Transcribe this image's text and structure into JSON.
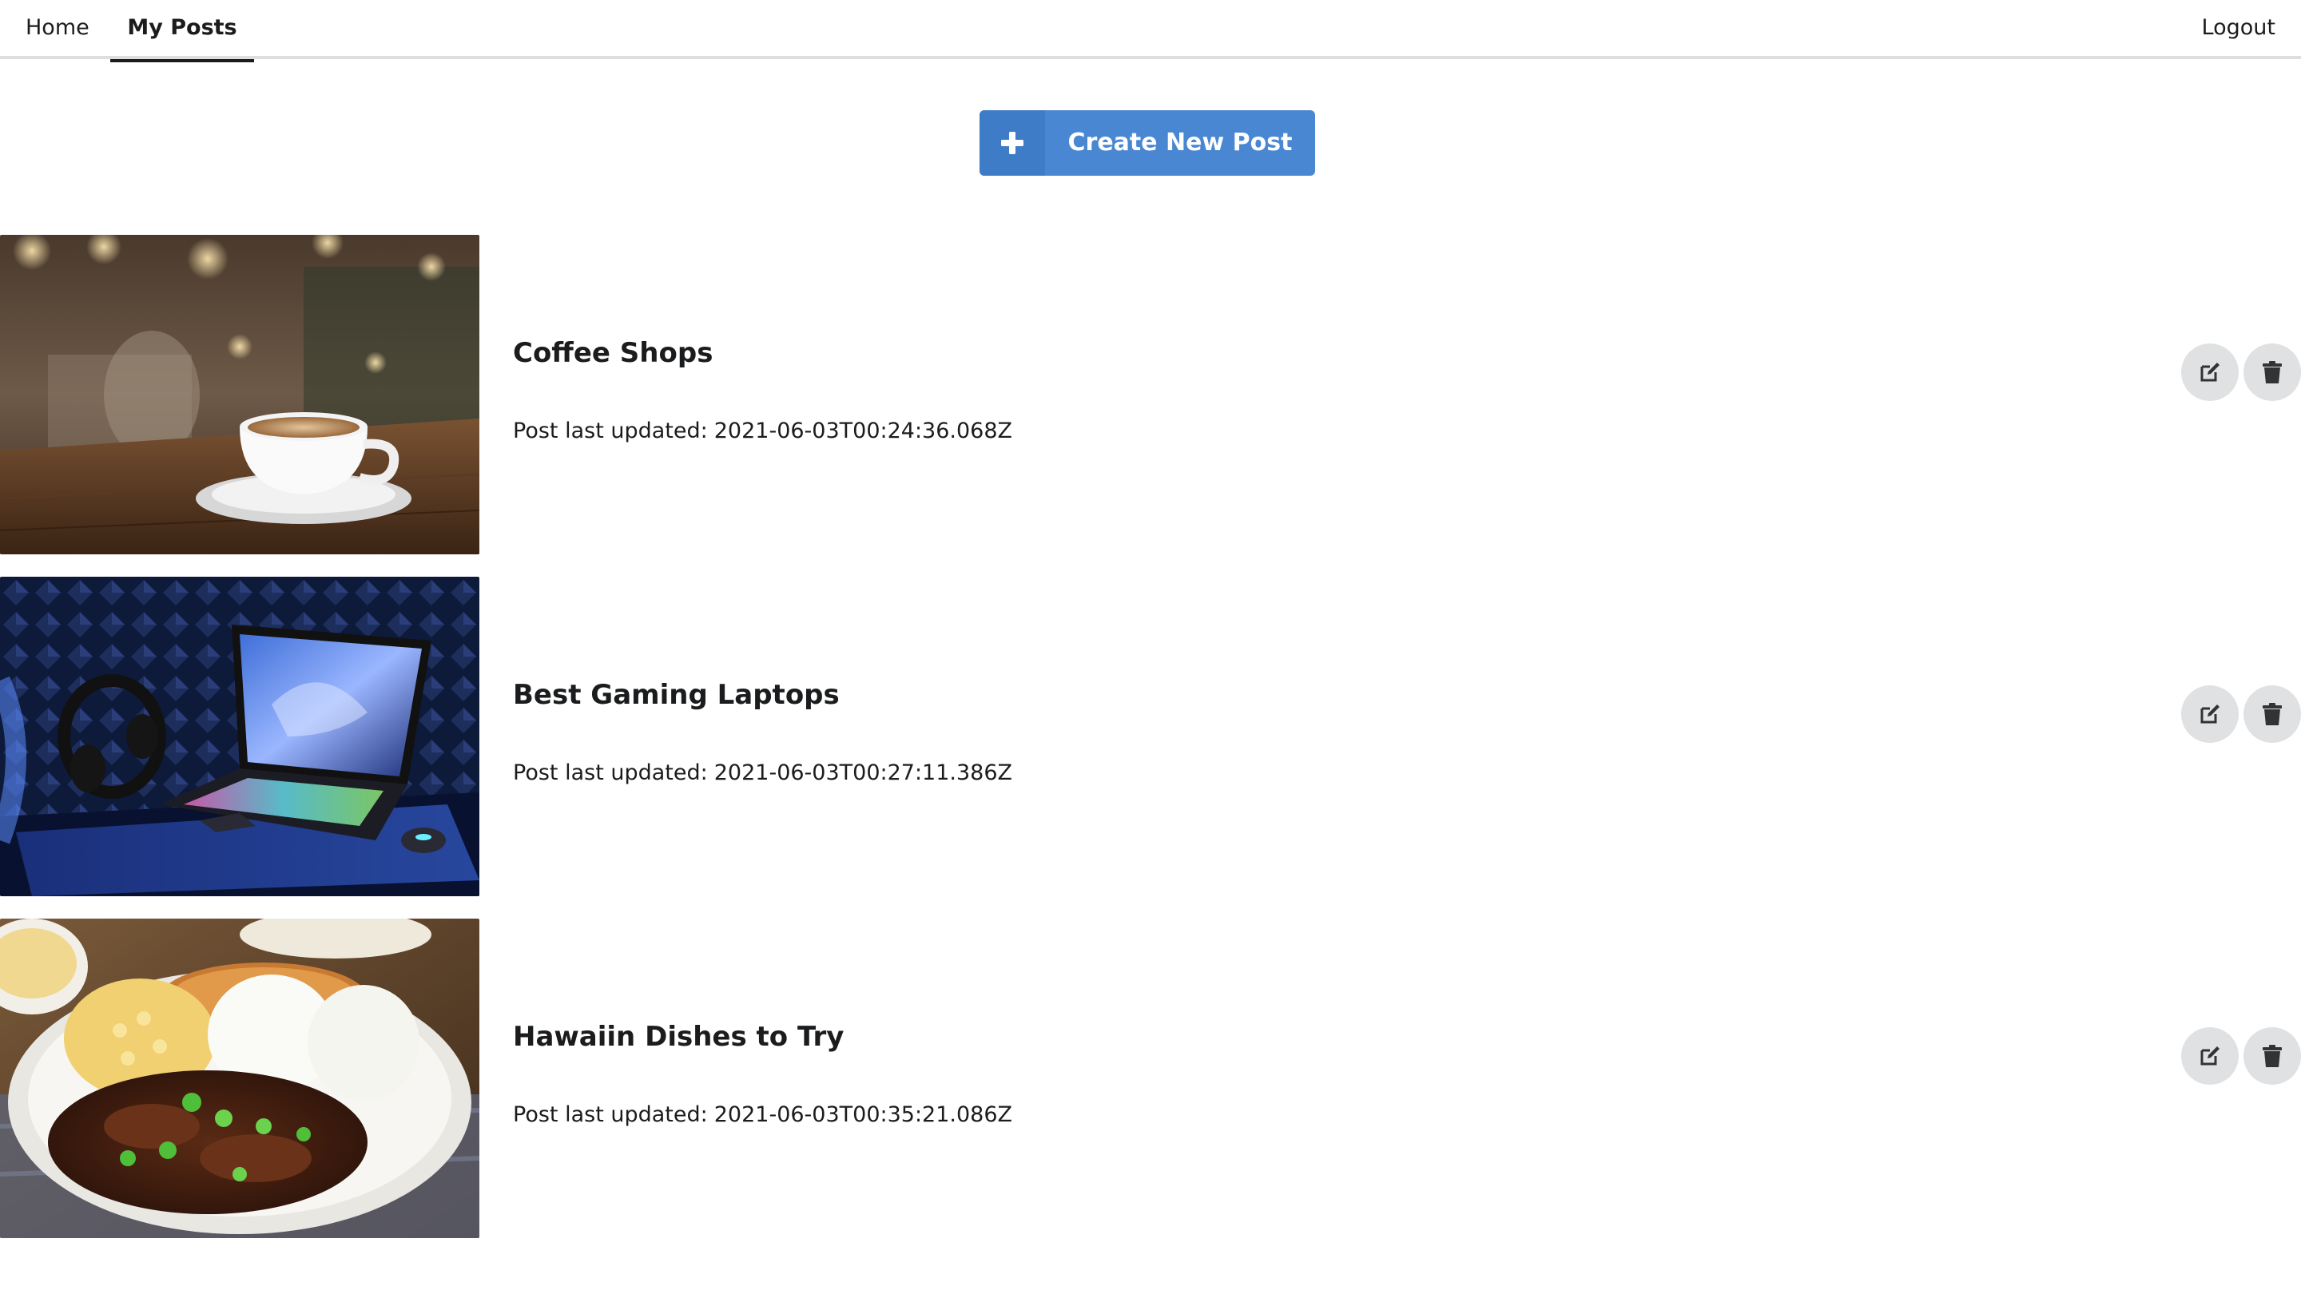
{
  "nav": {
    "home_label": "Home",
    "my_posts_label": "My Posts",
    "logout_label": "Logout",
    "active_tab": "My Posts"
  },
  "create_button": {
    "label": "Create New Post",
    "icon": "plus-icon",
    "color": "#4a87d2"
  },
  "posts": [
    {
      "title": "Coffee Shops",
      "updated_prefix": "Post last updated:",
      "updated_at": "2021-06-03T00:24:36.068Z",
      "image": "coffee-cup-photo",
      "actions": [
        "edit-icon",
        "trash-icon"
      ]
    },
    {
      "title": "Best Gaming Laptops",
      "updated_prefix": "Post last updated:",
      "updated_at": "2021-06-03T00:27:11.386Z",
      "image": "gaming-laptop-photo",
      "actions": [
        "edit-icon",
        "trash-icon"
      ]
    },
    {
      "title": "Hawaiin Dishes to Try",
      "updated_prefix": "Post last updated:",
      "updated_at": "2021-06-03T00:35:21.086Z",
      "image": "hawaiian-plate-photo",
      "actions": [
        "edit-icon",
        "trash-icon"
      ]
    }
  ]
}
